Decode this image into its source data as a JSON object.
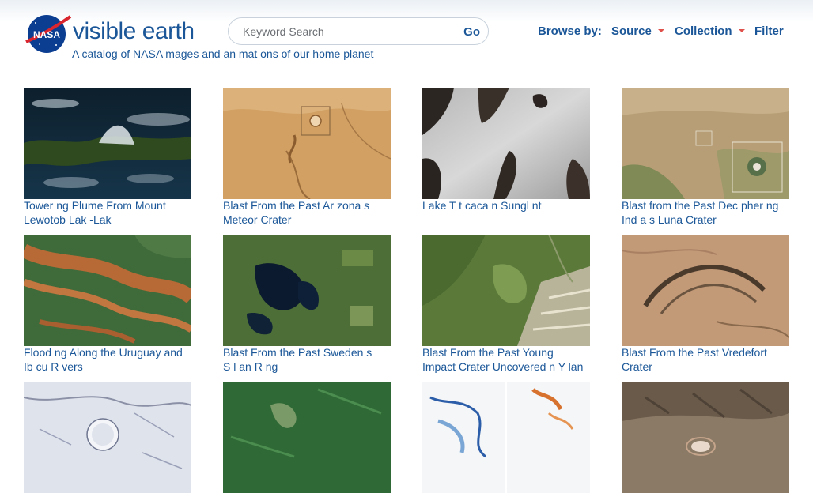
{
  "header": {
    "brand": "visible earth",
    "logo_text": "NASA",
    "tagline": "A catalog of NASA  mages and an mat ons of our home planet"
  },
  "search": {
    "placeholder": "Keyword Search",
    "value": "",
    "go_label": "Go"
  },
  "nav": {
    "browse_by": "Browse by:",
    "source": "Source",
    "collection": "Collection",
    "filter": "Filter"
  },
  "gallery": {
    "tiles": [
      {
        "caption": "Tower ng Plume From Mount\nLewotob  Lak -Lak"
      },
      {
        "caption": "Blast From the Past  Ar zona s\nMeteor Crater"
      },
      {
        "caption": "Lake T t caca  n Sungl nt"
      },
      {
        "caption": "Blast from the Past  Dec pher ng\nInd a s Luna Crater"
      },
      {
        "caption": "Flood ng Along the Uruguay and\nIb cu  R vers"
      },
      {
        "caption": "Blast From the Past  Sweden s\nS l an R ng"
      },
      {
        "caption": "Blast From the Past  Young\nImpact Crater Uncovered  n Y lan"
      },
      {
        "caption": "Blast From the Past  Vredefort\nCrater"
      },
      {
        "caption": ""
      },
      {
        "caption": ""
      },
      {
        "caption": ""
      },
      {
        "caption": ""
      }
    ]
  },
  "colors": {
    "brand": "#1b5798",
    "accent": "#e0514b",
    "nasa_blue": "#0b3d91"
  }
}
